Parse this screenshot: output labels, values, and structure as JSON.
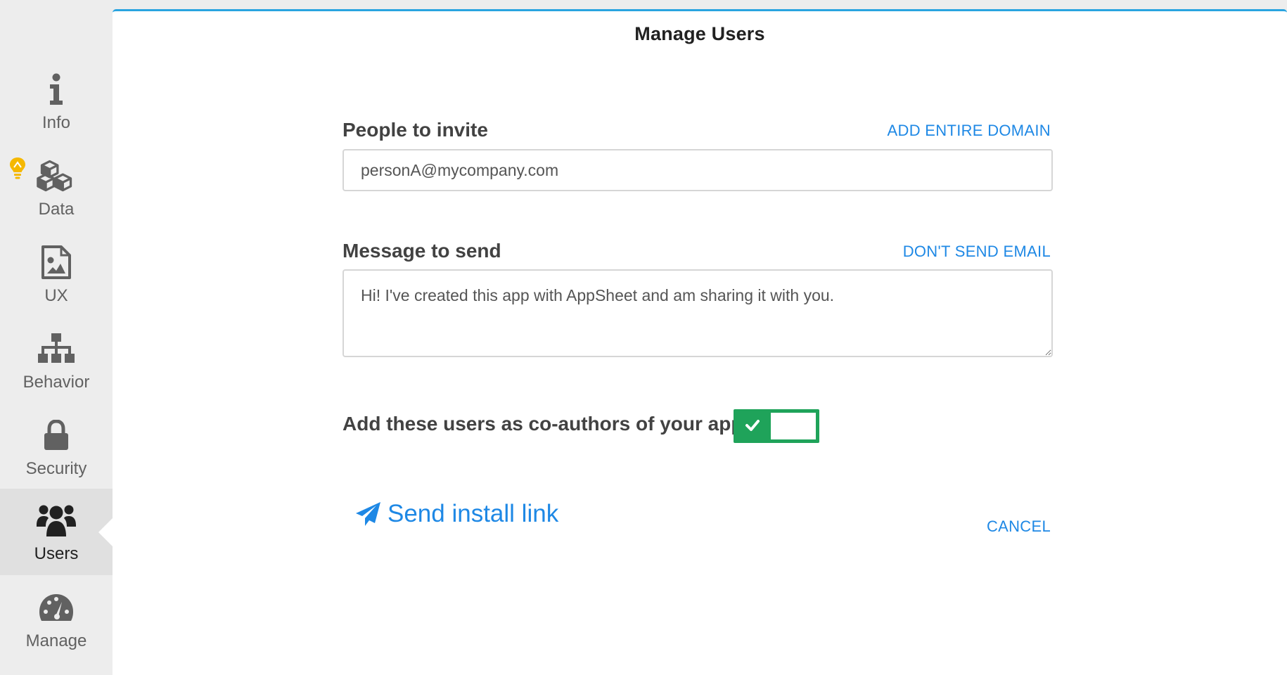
{
  "sidebar": {
    "items": [
      {
        "key": "info",
        "label": "Info",
        "icon": "info-icon"
      },
      {
        "key": "data",
        "label": "Data",
        "icon": "cubes-icon"
      },
      {
        "key": "ux",
        "label": "UX",
        "icon": "image-file-icon"
      },
      {
        "key": "behavior",
        "label": "Behavior",
        "icon": "sitemap-icon"
      },
      {
        "key": "security",
        "label": "Security",
        "icon": "lock-icon"
      },
      {
        "key": "users",
        "label": "Users",
        "icon": "users-icon",
        "active": true
      },
      {
        "key": "manage",
        "label": "Manage",
        "icon": "dashboard-icon"
      }
    ],
    "hint_icon": "lightbulb-icon"
  },
  "panel": {
    "title": "Manage Users",
    "people": {
      "label": "People to invite",
      "link": "ADD ENTIRE DOMAIN",
      "value": "personA@mycompany.com"
    },
    "message": {
      "label": "Message to send",
      "link": "DON'T SEND EMAIL",
      "value": "Hi! I've created this app with AppSheet and am sharing it with you."
    },
    "coauthors": {
      "label": "Add these users as co-authors of your app",
      "enabled": true
    },
    "send_label": "Send install link",
    "cancel_label": "CANCEL"
  },
  "colors": {
    "accent": "#1e88e5",
    "panel_border": "#2aa4e0",
    "toggle_on": "#1fa35a",
    "hint": "#f5b800"
  }
}
